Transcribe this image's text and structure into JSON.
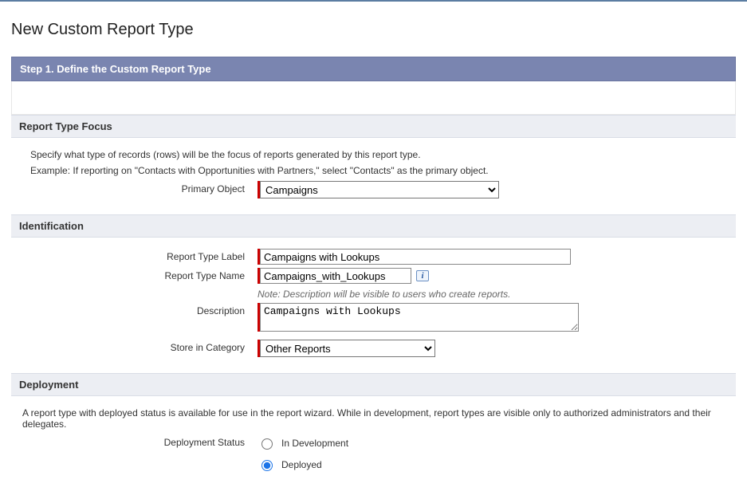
{
  "page": {
    "title": "New Custom Report Type"
  },
  "step": {
    "label": "Step 1. Define the Custom Report Type"
  },
  "focus": {
    "header": "Report Type Focus",
    "specify": "Specify what type of records (rows) will be the focus of reports generated by this report type.",
    "example": "Example: If reporting on \"Contacts with Opportunities with Partners,\" select \"Contacts\" as the primary object.",
    "primary_object_label": "Primary Object",
    "primary_object_value": "Campaigns"
  },
  "identification": {
    "header": "Identification",
    "label_label": "Report Type Label",
    "label_value": "Campaigns with Lookups",
    "name_label": "Report Type Name",
    "name_value": "Campaigns_with_Lookups",
    "note": "Note: Description will be visible to users who create reports.",
    "description_label": "Description",
    "description_value": "Campaigns with Lookups",
    "category_label": "Store in Category",
    "category_value": "Other Reports"
  },
  "deployment": {
    "header": "Deployment",
    "help": "A report type with deployed status is available for use in the report wizard. While in development, report types are visible only to authorized administrators and their delegates.",
    "status_label": "Deployment Status",
    "option_in_development": "In Development",
    "option_deployed": "Deployed",
    "selected": "deployed"
  }
}
